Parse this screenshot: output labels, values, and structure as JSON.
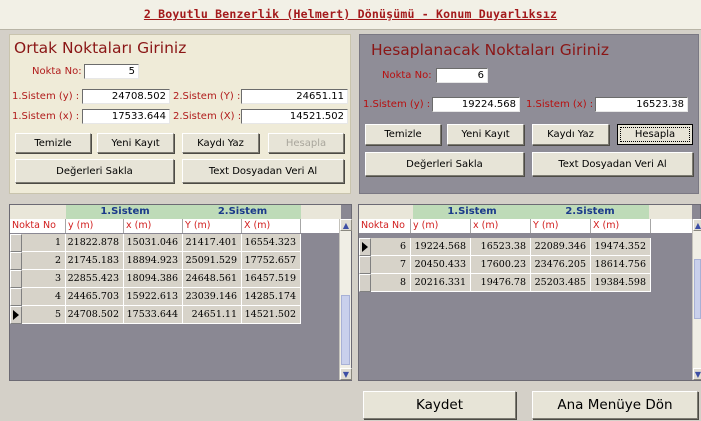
{
  "window": {
    "title": "2 Boyutlu Benzerlik (Helmert) Dönüşümü - Konum Duyarlıksız"
  },
  "left_panel": {
    "heading": "Ortak Noktaları Giriniz",
    "nokta_label": "Nokta No:",
    "nokta_value": "5",
    "y1_label": "1.Sistem (y) :",
    "y1_value": "24708.502",
    "x1_label": "1.Sistem (x) :",
    "x1_value": "17533.644",
    "y2_label": "2.Sistem (Y) :",
    "y2_value": "24651.11",
    "x2_label": "2.Sistem (X) :",
    "x2_value": "14521.502",
    "btn_temizle": "Temizle",
    "btn_yeni": "Yeni Kayıt",
    "btn_kaydi": "Kaydı Yaz",
    "btn_hesapla": "Hesapla",
    "btn_degerleri": "Değerleri Sakla",
    "btn_text": "Text Dosyadan Veri Al"
  },
  "right_panel": {
    "heading": "Hesaplanacak Noktaları Giriniz",
    "nokta_label": "Nokta No:",
    "nokta_value": "6",
    "y_label": "1.Sistem (y) :",
    "y_value": "19224.568",
    "x_label": "1.Sistem (x) :",
    "x_value": "16523.38",
    "btn_temizle": "Temizle",
    "btn_yeni": "Yeni Kayıt",
    "btn_kaydi": "Kaydı Yaz",
    "btn_hesapla": "Hesapla",
    "btn_degerleri": "Değerleri Sakla",
    "btn_text": "Text Dosyadan Veri Al"
  },
  "left_grid": {
    "sys1": "1.Sistem",
    "sys2": "2.Sistem",
    "headers": [
      "Nokta No",
      "y (m)",
      "x (m)",
      "Y (m)",
      "X (m)"
    ],
    "rows": [
      [
        "1",
        "21822.878",
        "15031.046",
        "21417.401",
        "16554.323"
      ],
      [
        "2",
        "21745.183",
        "18894.923",
        "25091.529",
        "17752.657"
      ],
      [
        "3",
        "22855.423",
        "18094.386",
        "24648.561",
        "16457.519"
      ],
      [
        "4",
        "24465.703",
        "15922.613",
        "23039.146",
        "14285.174"
      ],
      [
        "5",
        "24708.502",
        "17533.644",
        "24651.11",
        "14521.502"
      ]
    ]
  },
  "right_grid": {
    "sys1": "1.Sistem",
    "sys2": "2.Sistem",
    "headers": [
      "Nokta No",
      "y (m)",
      "x (m)",
      "Y (m)",
      "X (m)"
    ],
    "rows": [
      [
        "6",
        "19224.568",
        "16523.38",
        "22089.346",
        "19474.352"
      ],
      [
        "7",
        "20450.433",
        "17600.23",
        "23476.205",
        "18614.756"
      ],
      [
        "8",
        "20216.331",
        "19476.78",
        "25203.485",
        "19384.598"
      ]
    ]
  },
  "footer": {
    "kaydet": "Kaydet",
    "ana_menu": "Ana Menüye Dön"
  }
}
